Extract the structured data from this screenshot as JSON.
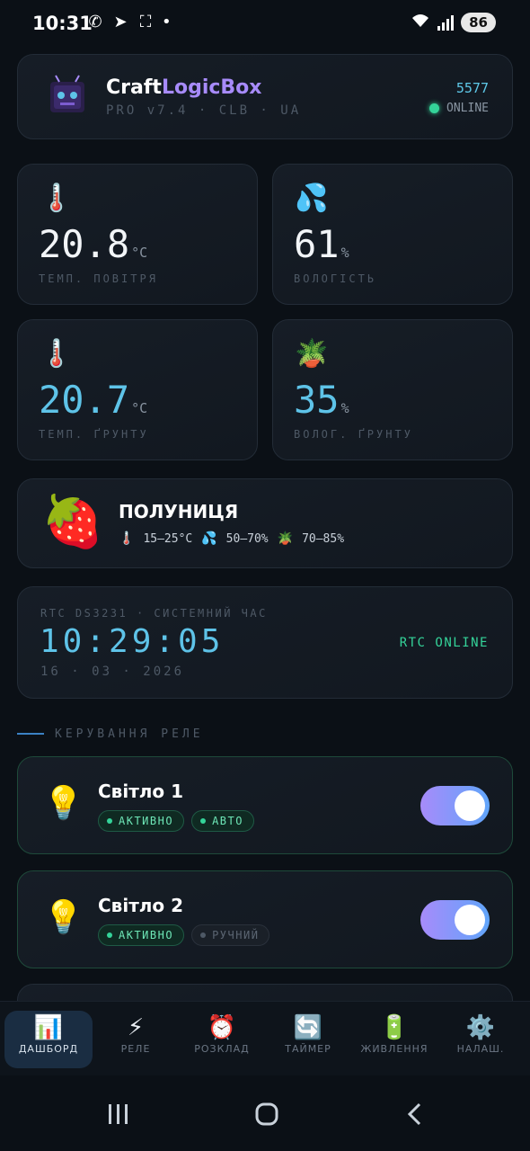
{
  "status_bar": {
    "time": "10:31",
    "battery": "86",
    "icons": [
      "messenger-icon",
      "telegram-icon",
      "screenshot-icon",
      "dot-icon"
    ]
  },
  "header": {
    "brand_a": "Craft",
    "brand_b": "LogicBox",
    "version": "PRO v7.4 · CLB · UA",
    "id": "5577",
    "status": "ONLINE"
  },
  "sensors": [
    {
      "icon": "🌡️",
      "value": "20.8",
      "unit": "°C",
      "label": "ТЕМП. ПОВІТРЯ"
    },
    {
      "icon": "💦",
      "value": "61",
      "unit": "%",
      "label": "ВОЛОГІСТЬ"
    },
    {
      "icon": "🌡️",
      "value": "20.7",
      "unit": "°C",
      "label": "ТЕМП. ҐРУНТУ"
    },
    {
      "icon": "🪴",
      "value": "35",
      "unit": "%",
      "label": "ВОЛОГ. ҐРУНТУ"
    }
  ],
  "plant": {
    "icon": "🍓",
    "name": "ПОЛУНИЦЯ",
    "temp_range": "15–25°C",
    "hum_range": "50–70%",
    "soil_range": "70–85%"
  },
  "clock": {
    "caption": "RTC DS3231 · СИСТЕМНИЙ ЧАС",
    "time": "10:29:05",
    "date": "16 · 03 · 2026",
    "status": "RTC ONLINE"
  },
  "section_title": "КЕРУВАННЯ РЕЛЕ",
  "relays": [
    {
      "name": "Світло 1",
      "badge1": "АКТИВНО",
      "badge2": "АВТО",
      "on": true
    },
    {
      "name": "Світло 2",
      "badge1": "АКТИВНО",
      "badge2": "РУЧНИЙ",
      "on": true
    }
  ],
  "nav": [
    {
      "icon": "📊",
      "label": "ДАШБОРД",
      "active": true
    },
    {
      "icon": "⚡",
      "label": "РЕЛЕ"
    },
    {
      "icon": "⏰",
      "label": "РОЗКЛАД"
    },
    {
      "icon": "🔄",
      "label": "ТАЙМЕР"
    },
    {
      "icon": "🔋",
      "label": "ЖИВЛЕННЯ"
    },
    {
      "icon": "⚙️",
      "label": "НАЛАШ."
    }
  ],
  "colors": {
    "accent_cyan": "#5ec3e8",
    "accent_green": "#34d399",
    "accent_purple": "#a78bfa"
  }
}
